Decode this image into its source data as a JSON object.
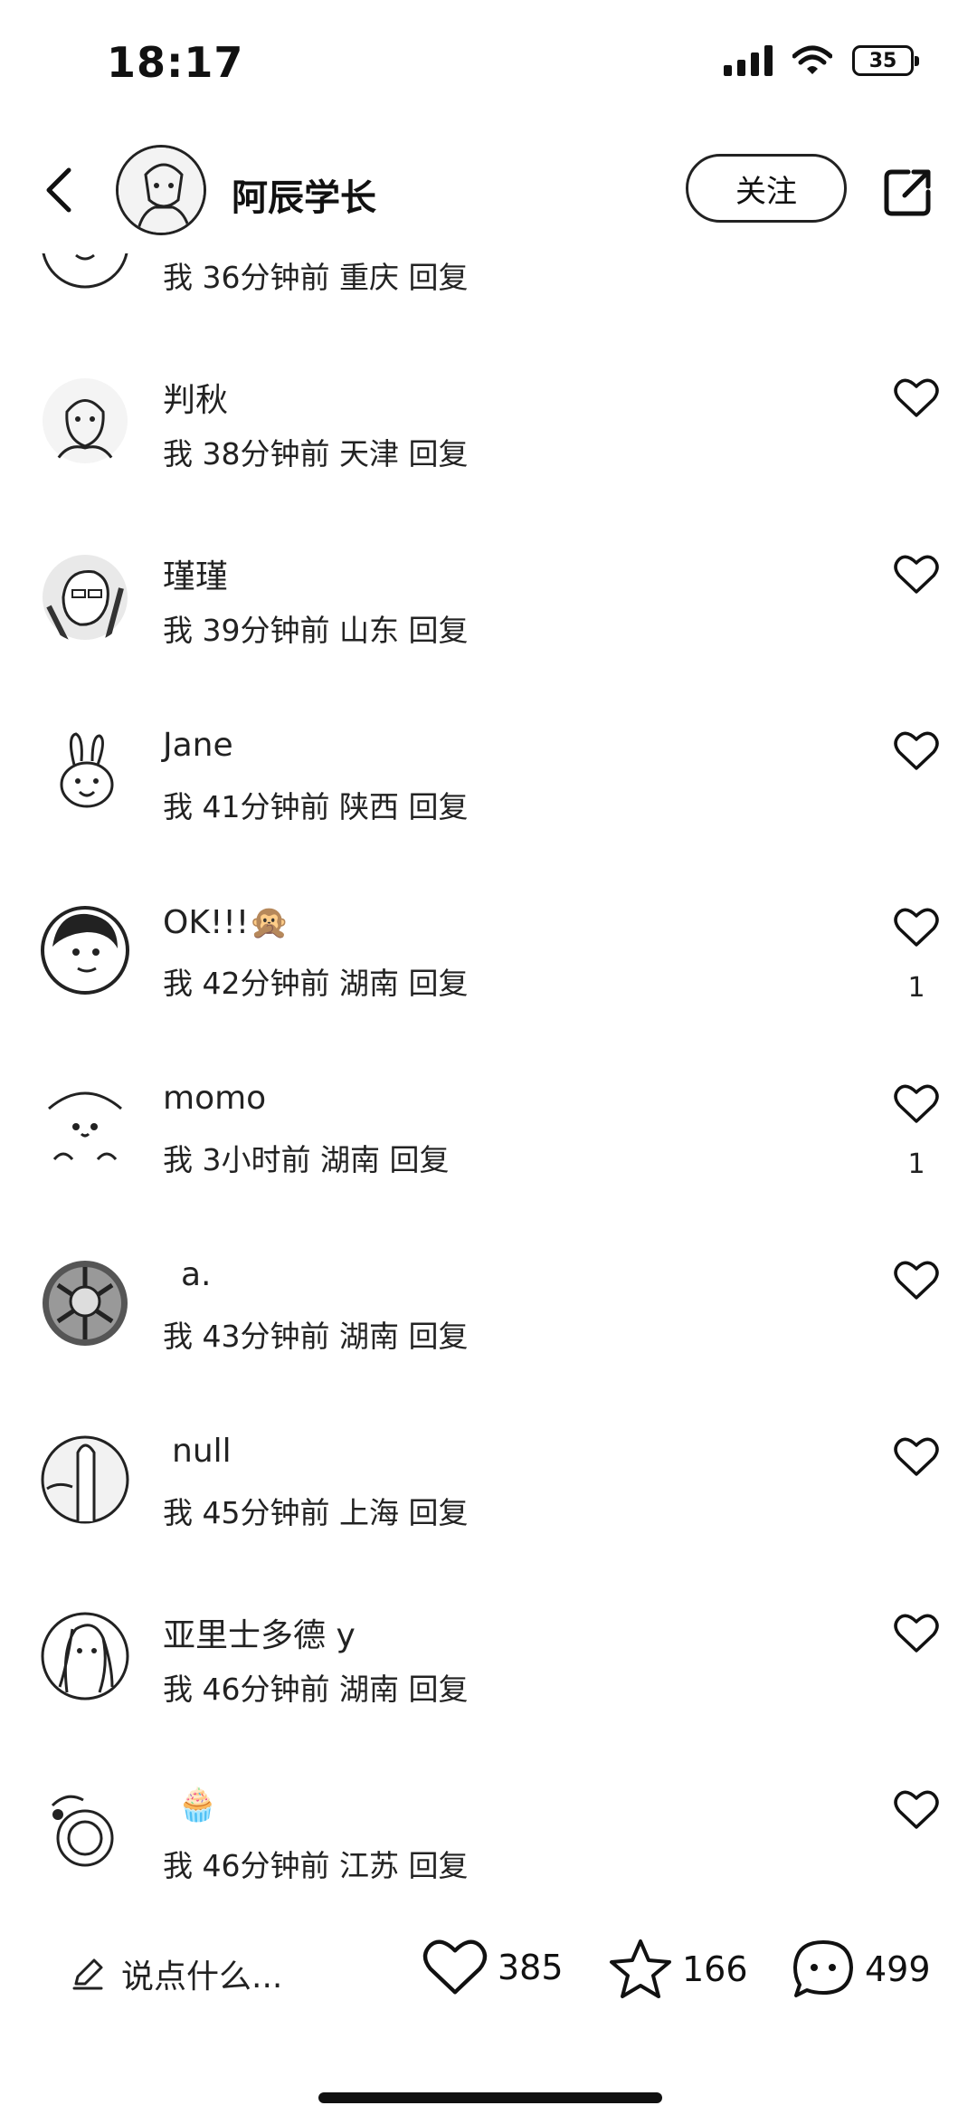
{
  "status_bar": {
    "time": "18:17",
    "battery": "35"
  },
  "header": {
    "author": "阿辰学长",
    "follow_label": "关注"
  },
  "comments": [
    {
      "username": "",
      "meta": "我 36分钟前 重庆 回复",
      "likes": ""
    },
    {
      "username": "判秋",
      "meta": "我 38分钟前 天津 回复",
      "likes": ""
    },
    {
      "username": "瑾瑾",
      "meta": "我 39分钟前 山东 回复",
      "likes": ""
    },
    {
      "username": "Jane",
      "meta": "我 41分钟前 陕西 回复",
      "likes": ""
    },
    {
      "username": "OK!!!🙊",
      "meta": "我 42分钟前 湖南 回复",
      "likes": "1"
    },
    {
      "username": "momo",
      "meta": "我 3小时前 湖南 回复",
      "likes": "1"
    },
    {
      "username": "a.",
      "meta": "我 43分钟前 湖南 回复",
      "likes": ""
    },
    {
      "username": "null",
      "meta": "我 45分钟前 上海 回复",
      "likes": ""
    },
    {
      "username": "亚里士多德 y",
      "meta": "我 46分钟前 湖南 回复",
      "likes": ""
    },
    {
      "username": "🧁",
      "meta": "我 46分钟前 江苏 回复",
      "likes": ""
    }
  ],
  "bottom_bar": {
    "input_placeholder": "说点什么...",
    "like_count": "385",
    "collect_count": "166",
    "comment_count": "499"
  },
  "icons": [
    "back-icon",
    "share-icon",
    "heart-icon",
    "star-icon",
    "comment-icon",
    "pencil-icon",
    "signal-icon",
    "wifi-icon",
    "battery-icon"
  ]
}
